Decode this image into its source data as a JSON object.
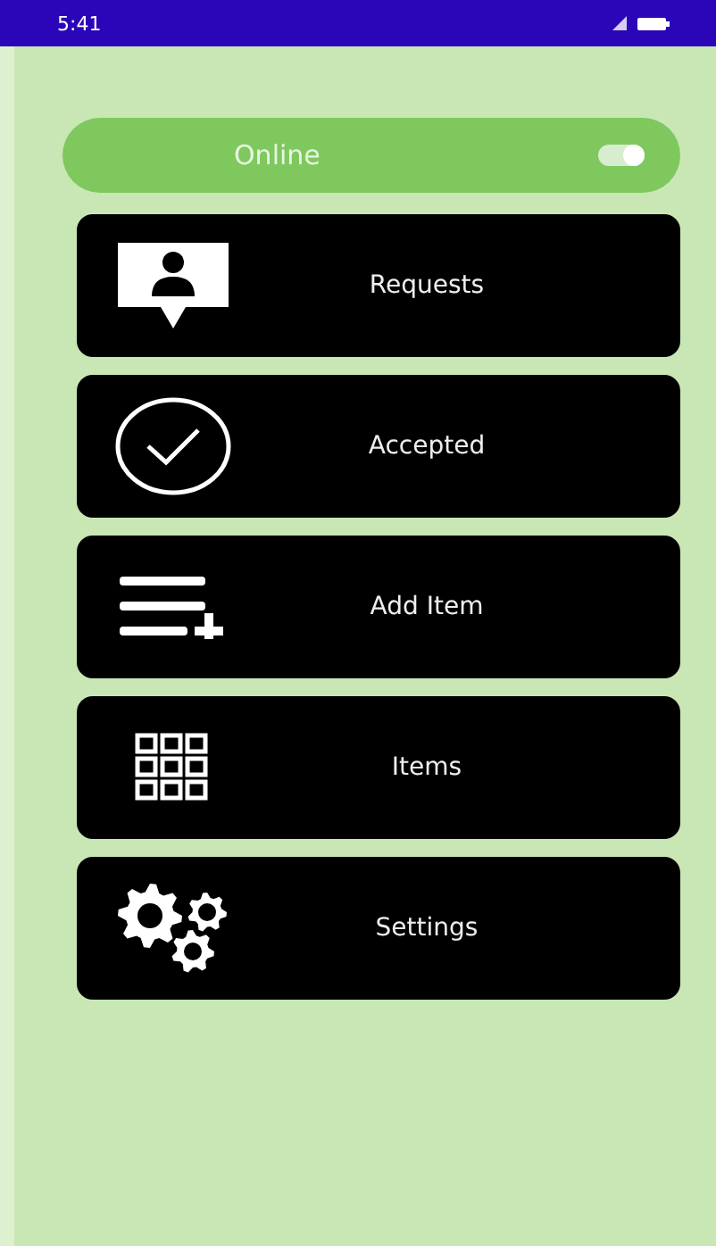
{
  "status_bar": {
    "time": "5:41"
  },
  "online": {
    "label": "Online",
    "on": true
  },
  "menu": [
    {
      "kind": "requests",
      "label": "Requests"
    },
    {
      "kind": "accepted",
      "label": "Accepted"
    },
    {
      "kind": "add",
      "label": "Add Item"
    },
    {
      "kind": "grid",
      "label": "Items"
    },
    {
      "kind": "settings",
      "label": "Settings"
    }
  ]
}
